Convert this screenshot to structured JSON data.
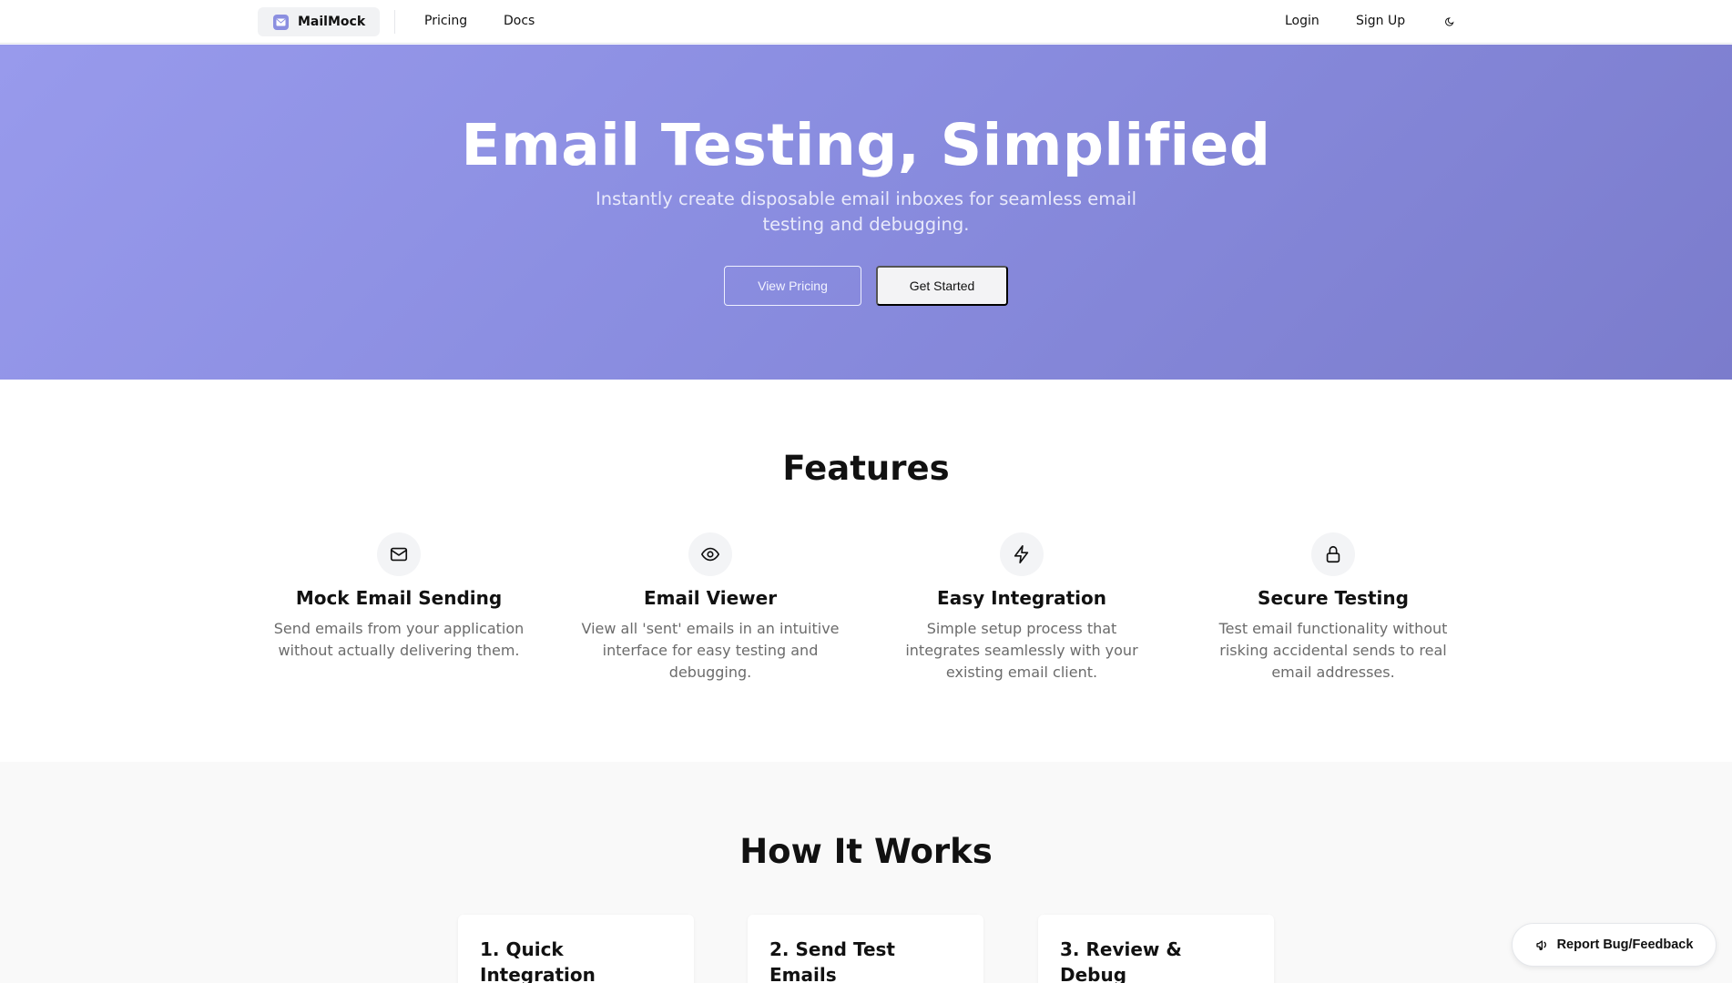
{
  "navbar": {
    "brand": "MailMock",
    "links": [
      "Pricing",
      "Docs"
    ],
    "login": "Login",
    "signup": "Sign Up",
    "theme_icon": "moon-icon"
  },
  "hero": {
    "title": "Email Testing, Simplified",
    "subtitle": "Instantly create disposable email inboxes for seamless email testing and debugging.",
    "view_pricing": "View Pricing",
    "get_started": "Get Started"
  },
  "features": {
    "title": "Features",
    "items": [
      {
        "icon": "mail-icon",
        "title": "Mock Email Sending",
        "desc": "Send emails from your application without actually delivering them."
      },
      {
        "icon": "eye-icon",
        "title": "Email Viewer",
        "desc": "View all 'sent' emails in an intuitive interface for easy testing and debugging."
      },
      {
        "icon": "lightning-icon",
        "title": "Easy Integration",
        "desc": "Simple setup process that integrates seamlessly with your existing email client."
      },
      {
        "icon": "lock-icon",
        "title": "Secure Testing",
        "desc": "Test email functionality without risking accidental sends to real email addresses."
      }
    ]
  },
  "how": {
    "title": "How It Works",
    "steps": [
      "1. Quick Integration",
      "2. Send Test Emails",
      "3. Review & Debug"
    ]
  },
  "feedback": {
    "label": "Report Bug/Feedback",
    "icon": "megaphone-icon"
  },
  "colors": {
    "hero_start": "#989aec",
    "hero_end": "#7b7ccc",
    "brand_icon": "#8b8fe0"
  }
}
